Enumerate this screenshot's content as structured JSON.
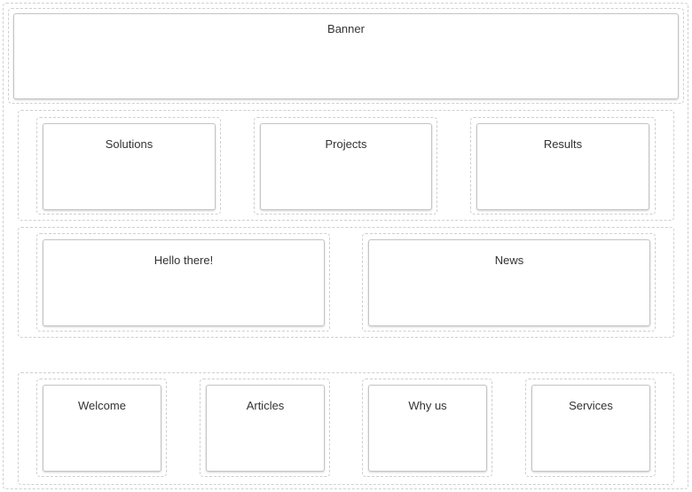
{
  "banner": {
    "title": "Banner"
  },
  "row1": [
    {
      "title": "Solutions"
    },
    {
      "title": "Projects"
    },
    {
      "title": "Results"
    }
  ],
  "row2": [
    {
      "title": "Hello there!"
    },
    {
      "title": "News"
    }
  ],
  "row3": [
    {
      "title": "Welcome"
    },
    {
      "title": "Articles"
    },
    {
      "title": "Why us"
    },
    {
      "title": "Services"
    }
  ]
}
